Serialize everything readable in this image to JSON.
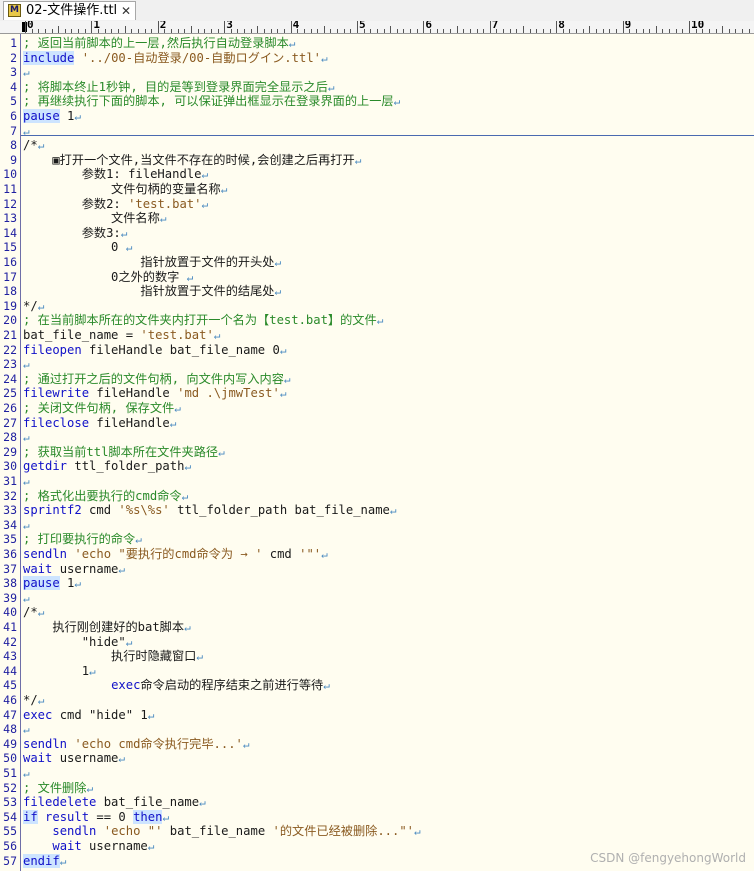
{
  "tab": {
    "icon": "M",
    "title": "02-文件操作.ttl",
    "close": "✕"
  },
  "ruler": {
    "labels": [
      "0",
      "1",
      "2",
      "3",
      "4",
      "5",
      "6",
      "7",
      "8",
      "9",
      "10"
    ]
  },
  "eol_glyph": "↵",
  "watermark": "CSDN @fengyehongWorld",
  "lines": [
    {
      "n": "1",
      "code": [
        {
          "t": "; 返回当前脚本的上一层,然后执行自动登录脚本",
          "c": "c"
        },
        {
          "t": "↵",
          "c": "eol"
        }
      ]
    },
    {
      "n": "2",
      "code": [
        {
          "t": "include",
          "c": "kh"
        },
        {
          "t": " "
        },
        {
          "t": "'../00-自动登录/00-自動ログイン.ttl'",
          "c": "s"
        },
        {
          "t": "↵",
          "c": "eol"
        }
      ]
    },
    {
      "n": "3",
      "code": [
        {
          "t": "↵",
          "c": "eol"
        }
      ]
    },
    {
      "n": "4",
      "code": [
        {
          "t": "; 将脚本终止1秒钟, 目的是等到登录界面完全显示之后",
          "c": "c"
        },
        {
          "t": "↵",
          "c": "eol"
        }
      ]
    },
    {
      "n": "5",
      "code": [
        {
          "t": "; 再继续执行下面的脚本, 可以保证弹出框显示在登录界面的上一层",
          "c": "c"
        },
        {
          "t": "↵",
          "c": "eol"
        }
      ]
    },
    {
      "n": "6",
      "code": [
        {
          "t": "pause",
          "c": "kh"
        },
        {
          "t": " 1"
        },
        {
          "t": "↵",
          "c": "eol"
        }
      ]
    },
    {
      "n": "7",
      "code": [
        {
          "t": "↵",
          "c": "eol"
        }
      ]
    },
    {
      "n": "8",
      "code": [
        {
          "t": "/*"
        },
        {
          "t": "↵",
          "c": "eol"
        }
      ]
    },
    {
      "n": "9",
      "code": [
        {
          "t": "    ▣打开一个文件,当文件不存在的时候,会创建之后再打开"
        },
        {
          "t": "↵",
          "c": "eol"
        }
      ]
    },
    {
      "n": "10",
      "code": [
        {
          "t": "        参数1: fileHandle"
        },
        {
          "t": "↵",
          "c": "eol"
        }
      ]
    },
    {
      "n": "11",
      "code": [
        {
          "t": "            文件句柄的变量名称"
        },
        {
          "t": "↵",
          "c": "eol"
        }
      ]
    },
    {
      "n": "12",
      "code": [
        {
          "t": "        参数2: "
        },
        {
          "t": "'test.bat'",
          "c": "s"
        },
        {
          "t": "↵",
          "c": "eol"
        }
      ]
    },
    {
      "n": "13",
      "code": [
        {
          "t": "            文件名称"
        },
        {
          "t": "↵",
          "c": "eol"
        }
      ]
    },
    {
      "n": "14",
      "code": [
        {
          "t": "        参数3:"
        },
        {
          "t": "↵",
          "c": "eol"
        }
      ]
    },
    {
      "n": "15",
      "code": [
        {
          "t": "            0 "
        },
        {
          "t": "↵",
          "c": "eol"
        }
      ]
    },
    {
      "n": "16",
      "code": [
        {
          "t": "                指针放置于文件的开头处"
        },
        {
          "t": "↵",
          "c": "eol"
        }
      ]
    },
    {
      "n": "17",
      "code": [
        {
          "t": "            0之外的数字 "
        },
        {
          "t": "↵",
          "c": "eol"
        }
      ]
    },
    {
      "n": "18",
      "code": [
        {
          "t": "                指针放置于文件的结尾处"
        },
        {
          "t": "↵",
          "c": "eol"
        }
      ]
    },
    {
      "n": "19",
      "code": [
        {
          "t": "*/"
        },
        {
          "t": "↵",
          "c": "eol"
        }
      ]
    },
    {
      "n": "20",
      "code": [
        {
          "t": "; 在当前脚本所在的文件夹内打开一个名为【test.bat】的文件",
          "c": "c"
        },
        {
          "t": "↵",
          "c": "eol"
        }
      ]
    },
    {
      "n": "21",
      "code": [
        {
          "t": "bat_file_name = "
        },
        {
          "t": "'test.bat'",
          "c": "s"
        },
        {
          "t": "↵",
          "c": "eol"
        }
      ]
    },
    {
      "n": "22",
      "code": [
        {
          "t": "fileopen",
          "c": "k"
        },
        {
          "t": " fileHandle bat_file_name 0"
        },
        {
          "t": "↵",
          "c": "eol"
        }
      ]
    },
    {
      "n": "23",
      "code": [
        {
          "t": "↵",
          "c": "eol"
        }
      ]
    },
    {
      "n": "24",
      "code": [
        {
          "t": "; 通过打开之后的文件句柄, 向文件内写入内容",
          "c": "c"
        },
        {
          "t": "↵",
          "c": "eol"
        }
      ]
    },
    {
      "n": "25",
      "code": [
        {
          "t": "filewrite",
          "c": "k"
        },
        {
          "t": " fileHandle "
        },
        {
          "t": "'md .\\jmwTest'",
          "c": "s"
        },
        {
          "t": "↵",
          "c": "eol"
        }
      ]
    },
    {
      "n": "26",
      "code": [
        {
          "t": "; 关闭文件句柄, 保存文件",
          "c": "c"
        },
        {
          "t": "↵",
          "c": "eol"
        }
      ]
    },
    {
      "n": "27",
      "code": [
        {
          "t": "fileclose",
          "c": "k"
        },
        {
          "t": " fileHandle"
        },
        {
          "t": "↵",
          "c": "eol"
        }
      ]
    },
    {
      "n": "28",
      "code": [
        {
          "t": "↵",
          "c": "eol"
        }
      ]
    },
    {
      "n": "29",
      "code": [
        {
          "t": "; 获取当前ttl脚本所在文件夹路径",
          "c": "c"
        },
        {
          "t": "↵",
          "c": "eol"
        }
      ]
    },
    {
      "n": "30",
      "code": [
        {
          "t": "getdir",
          "c": "k"
        },
        {
          "t": " ttl_folder_path"
        },
        {
          "t": "↵",
          "c": "eol"
        }
      ]
    },
    {
      "n": "31",
      "code": [
        {
          "t": "↵",
          "c": "eol"
        }
      ]
    },
    {
      "n": "32",
      "code": [
        {
          "t": "; 格式化出要执行的cmd命令",
          "c": "c"
        },
        {
          "t": "↵",
          "c": "eol"
        }
      ]
    },
    {
      "n": "33",
      "code": [
        {
          "t": "sprintf2",
          "c": "k"
        },
        {
          "t": " cmd "
        },
        {
          "t": "'%s\\%s'",
          "c": "s"
        },
        {
          "t": " ttl_folder_path bat_file_name"
        },
        {
          "t": "↵",
          "c": "eol"
        }
      ]
    },
    {
      "n": "34",
      "code": [
        {
          "t": "↵",
          "c": "eol"
        }
      ]
    },
    {
      "n": "35",
      "code": [
        {
          "t": "; 打印要执行的命令",
          "c": "c"
        },
        {
          "t": "↵",
          "c": "eol"
        }
      ]
    },
    {
      "n": "36",
      "code": [
        {
          "t": "sendln",
          "c": "k"
        },
        {
          "t": " "
        },
        {
          "t": "'echo \"要执行的cmd命令为 → '",
          "c": "s"
        },
        {
          "t": " cmd "
        },
        {
          "t": "'\"'",
          "c": "s"
        },
        {
          "t": "↵",
          "c": "eol"
        }
      ]
    },
    {
      "n": "37",
      "code": [
        {
          "t": "wait",
          "c": "k"
        },
        {
          "t": " username"
        },
        {
          "t": "↵",
          "c": "eol"
        }
      ]
    },
    {
      "n": "38",
      "code": [
        {
          "t": "pause",
          "c": "kh"
        },
        {
          "t": " 1"
        },
        {
          "t": "↵",
          "c": "eol"
        }
      ]
    },
    {
      "n": "39",
      "code": [
        {
          "t": "↵",
          "c": "eol"
        }
      ]
    },
    {
      "n": "40",
      "code": [
        {
          "t": "/*"
        },
        {
          "t": "↵",
          "c": "eol"
        }
      ]
    },
    {
      "n": "41",
      "code": [
        {
          "t": "    执行刚创建好的bat脚本"
        },
        {
          "t": "↵",
          "c": "eol"
        }
      ]
    },
    {
      "n": "42",
      "code": [
        {
          "t": "        \"hide\""
        },
        {
          "t": "↵",
          "c": "eol"
        }
      ]
    },
    {
      "n": "43",
      "code": [
        {
          "t": "            执行时隐藏窗口"
        },
        {
          "t": "↵",
          "c": "eol"
        }
      ]
    },
    {
      "n": "44",
      "code": [
        {
          "t": "        1"
        },
        {
          "t": "↵",
          "c": "eol"
        }
      ]
    },
    {
      "n": "45",
      "code": [
        {
          "t": "            "
        },
        {
          "t": "exec",
          "c": "k"
        },
        {
          "t": "命令启动的程序结束之前进行等待"
        },
        {
          "t": "↵",
          "c": "eol"
        }
      ]
    },
    {
      "n": "46",
      "code": [
        {
          "t": "*/"
        },
        {
          "t": "↵",
          "c": "eol"
        }
      ]
    },
    {
      "n": "47",
      "code": [
        {
          "t": "exec",
          "c": "k"
        },
        {
          "t": " cmd \"hide\" 1"
        },
        {
          "t": "↵",
          "c": "eol"
        }
      ]
    },
    {
      "n": "48",
      "code": [
        {
          "t": "↵",
          "c": "eol"
        }
      ]
    },
    {
      "n": "49",
      "code": [
        {
          "t": "sendln",
          "c": "k"
        },
        {
          "t": " "
        },
        {
          "t": "'echo cmd命令执行完毕...'",
          "c": "s"
        },
        {
          "t": "↵",
          "c": "eol"
        }
      ]
    },
    {
      "n": "50",
      "code": [
        {
          "t": "wait",
          "c": "k"
        },
        {
          "t": " username"
        },
        {
          "t": "↵",
          "c": "eol"
        }
      ]
    },
    {
      "n": "51",
      "code": [
        {
          "t": "↵",
          "c": "eol"
        }
      ]
    },
    {
      "n": "52",
      "code": [
        {
          "t": "; 文件删除",
          "c": "c"
        },
        {
          "t": "↵",
          "c": "eol"
        }
      ]
    },
    {
      "n": "53",
      "code": [
        {
          "t": "filedelete",
          "c": "k"
        },
        {
          "t": " bat_file_name"
        },
        {
          "t": "↵",
          "c": "eol"
        }
      ]
    },
    {
      "n": "54",
      "code": [
        {
          "t": "if",
          "c": "kh"
        },
        {
          "t": " "
        },
        {
          "t": "result",
          "c": "k"
        },
        {
          "t": " == 0 "
        },
        {
          "t": "then",
          "c": "kh"
        },
        {
          "t": "↵",
          "c": "eol"
        }
      ]
    },
    {
      "n": "55",
      "code": [
        {
          "t": "    "
        },
        {
          "t": "sendln",
          "c": "k"
        },
        {
          "t": " "
        },
        {
          "t": "'echo \"'",
          "c": "s"
        },
        {
          "t": " bat_file_name "
        },
        {
          "t": "'的文件已经被删除...\"'",
          "c": "s"
        },
        {
          "t": "↵",
          "c": "eol"
        }
      ]
    },
    {
      "n": "56",
      "code": [
        {
          "t": "    "
        },
        {
          "t": "wait",
          "c": "k"
        },
        {
          "t": " username"
        },
        {
          "t": "↵",
          "c": "eol"
        }
      ]
    },
    {
      "n": "57",
      "code": [
        {
          "t": "endif",
          "c": "kh"
        },
        {
          "t": "↵",
          "c": "eol"
        }
      ]
    }
  ]
}
